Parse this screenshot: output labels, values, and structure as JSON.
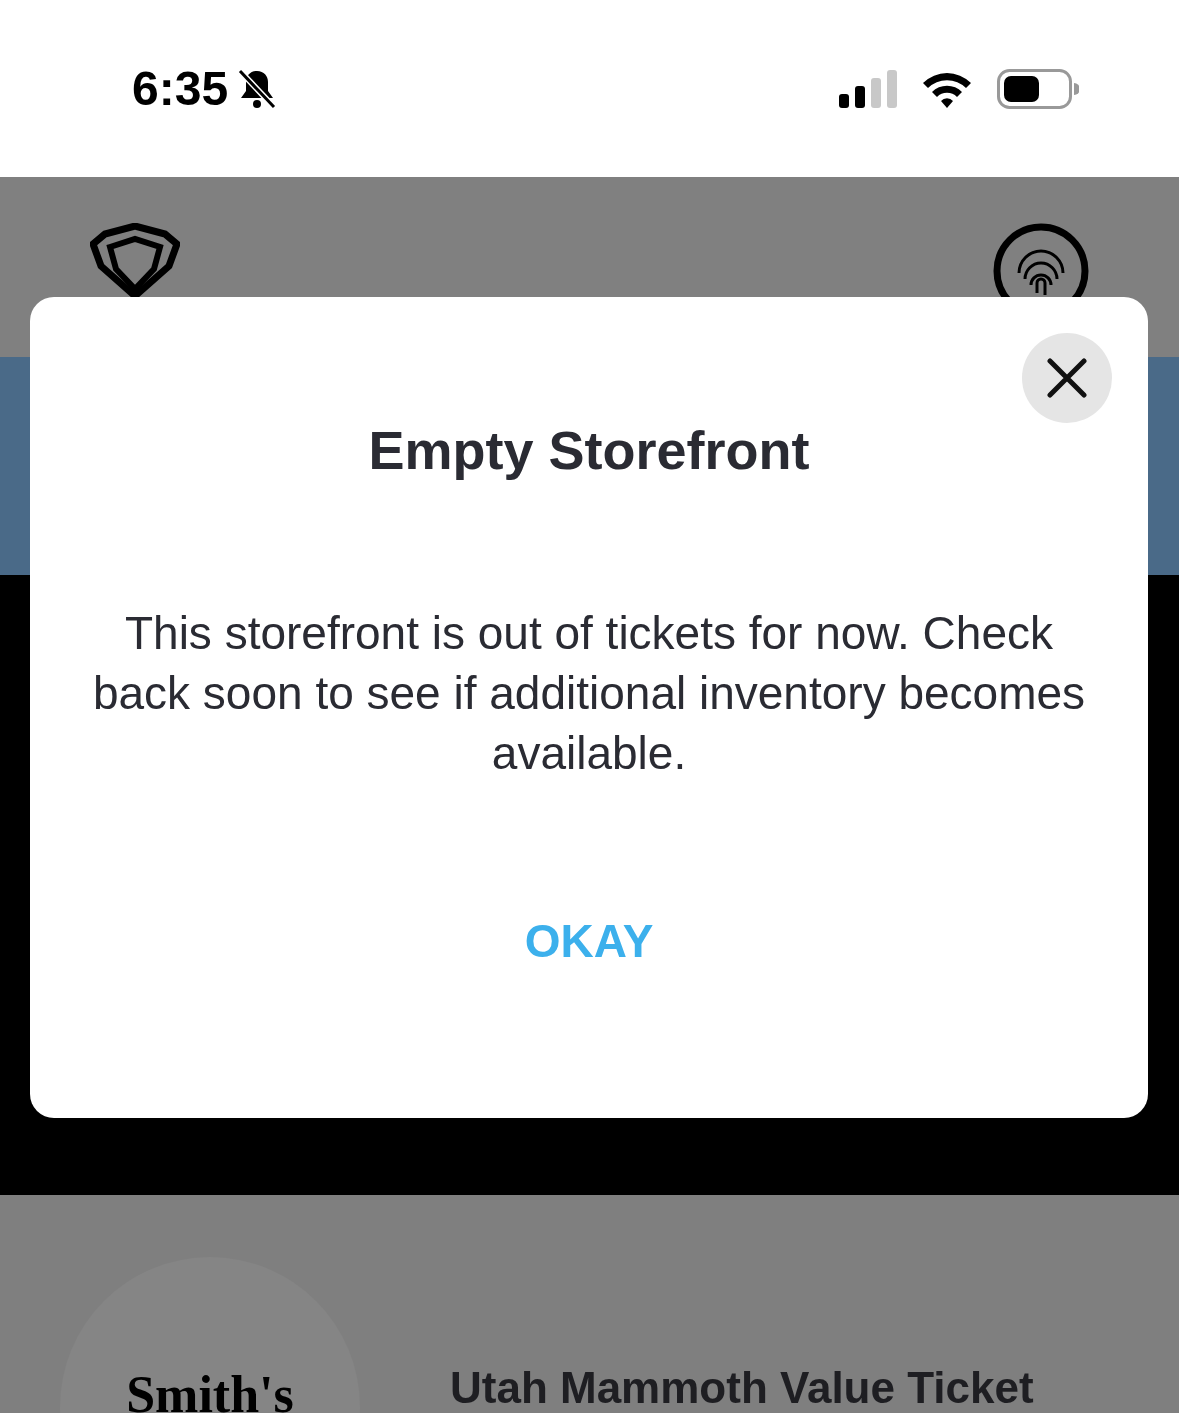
{
  "status_bar": {
    "time": "6:35"
  },
  "dialog": {
    "title": "Empty Storefront",
    "message": "This storefront is out of tickets for now. Check back soon to see if additional inventory becomes available.",
    "button": "OKAY"
  },
  "listing": {
    "logo_text": "Smith's",
    "title": "Utah Mammoth Value Ticket"
  }
}
